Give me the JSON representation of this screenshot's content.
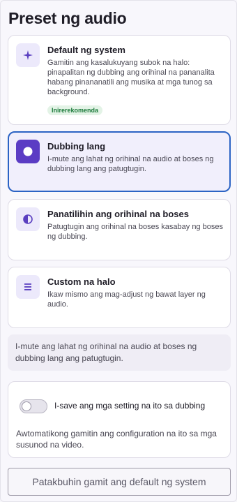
{
  "title": "Preset ng audio",
  "presets": [
    {
      "icon": "sparkle-icon",
      "title": "Default ng system",
      "description": "Gamitin ang kasalukuyang subok na halo: pinapalitan ng dubbing ang orihinal na pananalita habang pinananatili ang musika at mga tunog sa background.",
      "badge": "Inirerekomenda",
      "selected": false
    },
    {
      "icon": "circle-icon",
      "title": "Dubbing lang",
      "description": "I-mute ang lahat ng orihinal na audio at boses ng dubbing lang ang patugtugin.",
      "selected": true
    },
    {
      "icon": "half-circle-icon",
      "title": "Panatilihin ang orihinal na boses",
      "description": "Patugtugin ang orihinal na boses kasabay ng boses ng dubbing.",
      "selected": false
    },
    {
      "icon": "lines-icon",
      "title": "Custom na halo",
      "description": "Ikaw mismo ang mag-adjust ng bawat layer ng audio.",
      "selected": false
    }
  ],
  "info_text": "I-mute ang lahat ng orihinal na audio at boses ng dubbing lang ang patugtugin.",
  "save_setting": {
    "label": "I-save ang mga setting na ito sa dubbing",
    "enabled": false,
    "description": "Awtomatikong gamitin ang configuration na ito sa mga susunod na video."
  },
  "reset_button": "Patakbuhin gamit ang default ng system",
  "colors": {
    "accent": "#5b3cc4",
    "selected_border": "#2b63c4",
    "badge_text": "#1b7a3a"
  }
}
